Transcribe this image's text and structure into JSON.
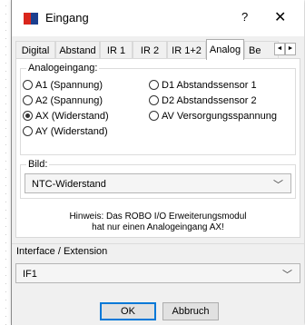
{
  "window": {
    "title": "Eingang",
    "help": "?",
    "close": "✕"
  },
  "tabs": [
    "Digital",
    "Abstand",
    "IR 1",
    "IR 2",
    "IR 1+2",
    "Analog",
    "Be"
  ],
  "tab_scroll": {
    "left": "◄",
    "right": "►"
  },
  "analog": {
    "group_title": "Analogeingang:",
    "left": [
      "A1 (Spannung)",
      "A2 (Spannung)",
      "AX (Widerstand)",
      "AY (Widerstand)"
    ],
    "right": [
      "D1 Abstandssensor 1",
      "D2 Abstandssensor 2",
      "AV Versorgungsspannung"
    ],
    "selected": "AX (Widerstand)"
  },
  "bild": {
    "label": "Bild:",
    "value": "NTC-Widerstand"
  },
  "hint": {
    "line1": "Hinweis: Das ROBO I/O Erweiterungsmodul",
    "line2": "hat nur einen Analogeingang AX!"
  },
  "interface": {
    "label": "Interface / Extension",
    "value": "IF1"
  },
  "buttons": {
    "ok": "OK",
    "cancel": "Abbruch"
  }
}
